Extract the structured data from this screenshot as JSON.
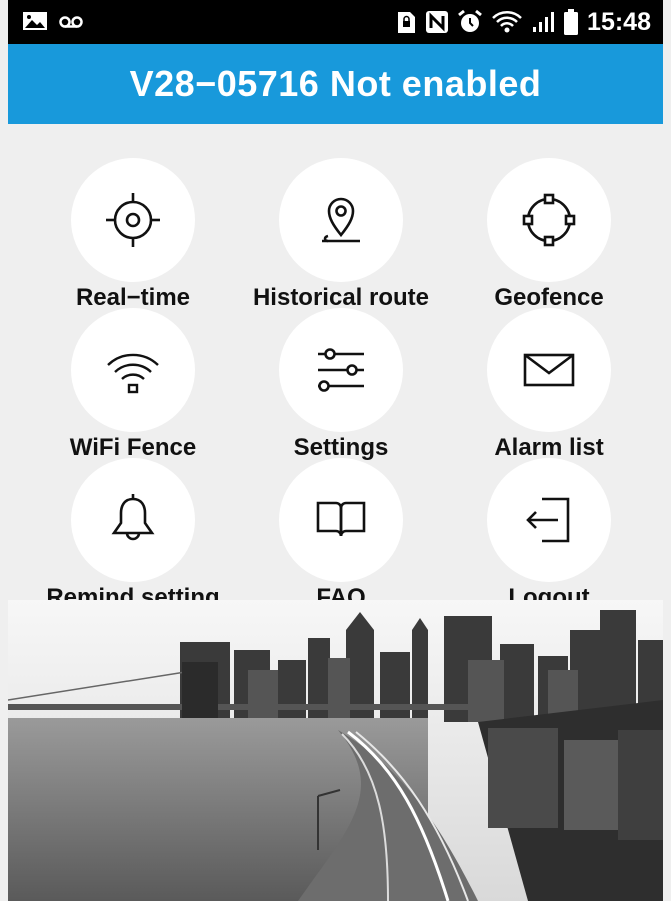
{
  "status_bar": {
    "time": "15:48"
  },
  "header": {
    "title": "V28−05716 Not enabled"
  },
  "menu": [
    {
      "label": "Real−time",
      "icon": "crosshair-icon"
    },
    {
      "label": "Historical route",
      "icon": "location-pin-icon"
    },
    {
      "label": "Geofence",
      "icon": "geofence-icon"
    },
    {
      "label": "WiFi Fence",
      "icon": "wifi-icon"
    },
    {
      "label": "Settings",
      "icon": "sliders-icon"
    },
    {
      "label": "Alarm list",
      "icon": "envelope-icon"
    },
    {
      "label": "Remind setting",
      "icon": "bell-icon"
    },
    {
      "label": "FAQ",
      "icon": "book-icon"
    },
    {
      "label": "Logout",
      "icon": "logout-icon"
    }
  ],
  "colors": {
    "header_bg": "#1899db",
    "status_bg": "#000000",
    "page_bg": "#efefef"
  }
}
